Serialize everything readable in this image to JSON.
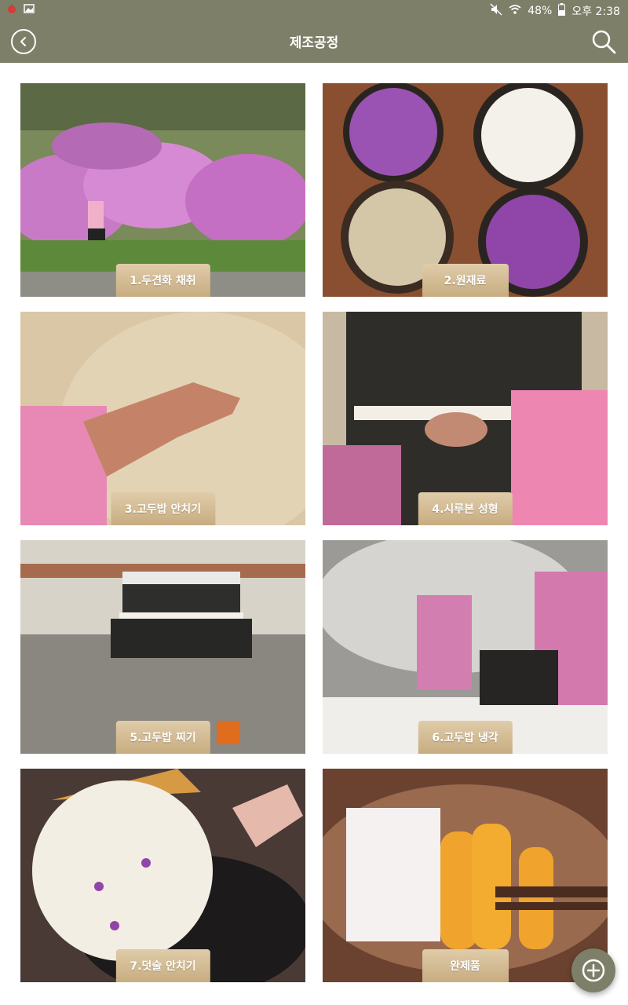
{
  "status_bar": {
    "battery": "48%",
    "time": "오후 2:38"
  },
  "header": {
    "title": "제조공정"
  },
  "steps": [
    {
      "label": "1.두견화 채취"
    },
    {
      "label": "2.원재료"
    },
    {
      "label": "3.고두밥 안치기"
    },
    {
      "label": "4.시루본 성형"
    },
    {
      "label": "5.고두밥 찌기"
    },
    {
      "label": "6.고두밥 냉각"
    },
    {
      "label": "7.덧술 안치기"
    },
    {
      "label": "완제품"
    }
  ],
  "colors": {
    "bar": "#7d7f68",
    "label_gold": "#d0b68c"
  }
}
